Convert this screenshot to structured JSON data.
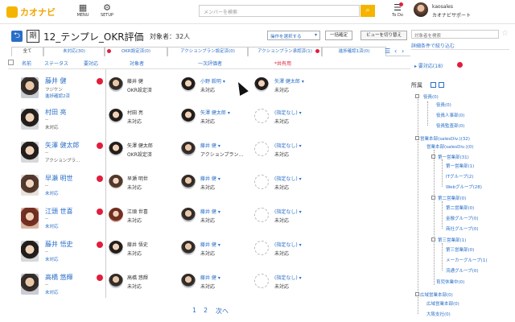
{
  "app": {
    "logo_text": "カオナビ",
    "nav": [
      {
        "label": "MENU",
        "icon": "grid-icon"
      },
      {
        "label": "SETUP",
        "icon": "gear-icon"
      }
    ],
    "search_placeholder": "メンバーを検索",
    "todo_label": "To Do",
    "user": {
      "name": "kaosales",
      "org": "カオナビサポート"
    }
  },
  "header": {
    "term_label": "期",
    "title": "12_テンプレ_OKR評価",
    "target_count": "対象者：32人",
    "operation_select": "操作を選択する",
    "confirm_all": "一括確定",
    "switch_view": "ビューを切り替え"
  },
  "tabs": [
    {
      "label": "全て",
      "active": true
    },
    {
      "label": "未対応(30)",
      "active": false
    },
    {
      "label": "OKR設定済(0)",
      "active": false
    },
    {
      "label": "アクションプラン設定済(0)",
      "active": false
    },
    {
      "label": "アクションプラン承認済(1)",
      "active": false
    },
    {
      "label": "進捗確認1済(0)",
      "active": false
    }
  ],
  "columns": {
    "name": "名前",
    "status": "ステータス",
    "my_action": "要対応",
    "target": "対象者",
    "first_rater": "一次評価者",
    "shared": "*共有用"
  },
  "rows": [
    {
      "name": "藤井 健",
      "sub1": "フジケン",
      "sub2": "進捗確認2済",
      "sub2_link": true,
      "target_name": "藤井 健",
      "target_status": "OKR設定済",
      "rater_name": "小野 毅明",
      "rater_status": "未対応",
      "rater_avatar": true,
      "shared_name": "矢澤 健太郎",
      "shared_status": "未対応",
      "shared_avatar": true
    },
    {
      "name": "村田 亮",
      "sub1": "--",
      "sub2": "未対応",
      "sub2_link": false,
      "target_name": "村田 亮",
      "target_status": "未対応",
      "rater_name": "矢澤 健太郎",
      "rater_status": "未対応",
      "rater_avatar": true,
      "shared_name": "(指定なし)",
      "shared_status": "未対応",
      "shared_avatar": false
    },
    {
      "name": "矢澤 健太郎",
      "sub1": "--",
      "sub2": "アクションプラ...",
      "sub2_link": false,
      "target_name": "矢澤 健太郎",
      "target_status": "OKR設定済",
      "rater_name": "藤井 健",
      "rater_status": "アクションプラン...",
      "rater_avatar": true,
      "shared_name": "(指定なし)",
      "shared_status": "未対応",
      "shared_avatar": false
    },
    {
      "name": "早瀬 明世",
      "sub1": "--",
      "sub2": "未対応",
      "sub2_link": true,
      "target_name": "早瀬 明世",
      "target_status": "未対応",
      "rater_name": "藤井 健",
      "rater_status": "未対応",
      "rater_avatar": true,
      "shared_name": "(指定なし)",
      "shared_status": "未対応",
      "shared_avatar": false
    },
    {
      "name": "江頭 世喜",
      "sub1": "--",
      "sub2": "未対応",
      "sub2_link": true,
      "target_name": "江頭 世喜",
      "target_status": "未対応",
      "rater_name": "藤井 健",
      "rater_status": "未対応",
      "rater_avatar": true,
      "shared_name": "(指定なし)",
      "shared_status": "未対応",
      "shared_avatar": false
    },
    {
      "name": "藤井 悟史",
      "sub1": "--",
      "sub2": "未対応",
      "sub2_link": true,
      "target_name": "藤井 悟史",
      "target_status": "未対応",
      "rater_name": "藤井 健",
      "rater_status": "未対応",
      "rater_avatar": true,
      "shared_name": "(指定なし)",
      "shared_status": "未対応",
      "shared_avatar": false
    },
    {
      "name": "高橋 悠輝",
      "sub1": "--",
      "sub2": "未対応",
      "sub2_link": true,
      "target_name": "高橋 悠輝",
      "target_status": "未対応",
      "rater_name": "藤井 健",
      "rater_status": "未対応",
      "rater_avatar": true,
      "shared_name": "(指定なし)",
      "shared_status": "未対応",
      "shared_avatar": false
    }
  ],
  "pagination": {
    "pages": [
      "1",
      "2"
    ],
    "next": "次へ"
  },
  "right_panel": {
    "search_placeholder": "対象者を検索",
    "detail_filter": "詳細条件で絞り込む",
    "my_action": "要対応(18)",
    "org_title": "所属",
    "tree": [
      "役員(0)",
      "役員(0)",
      "役員人事部(0)",
      "役員監査部(0)",
      "営業本部(salesDiv.)(32)",
      "営業本部(salesDiv.)(0)",
      "第一営業部(31)",
      "第一営業部(1)",
      "ITグループ(2)",
      "Webグループ(28)",
      "第二営業部(0)",
      "第二営業部(0)",
      "金融グループ(0)",
      "商社グループ(0)",
      "第三営業部(1)",
      "第三営業部(0)",
      "メーカーグループ(1)",
      "流通グループ(0)",
      "育児休業中(0)",
      "広域営業本部(0)",
      "広域営業本部(0)",
      "大阪支社(0)"
    ]
  },
  "colors": {
    "accent": "#2a6fc8",
    "alert": "#e01e3c",
    "brand": "#f5b400"
  }
}
